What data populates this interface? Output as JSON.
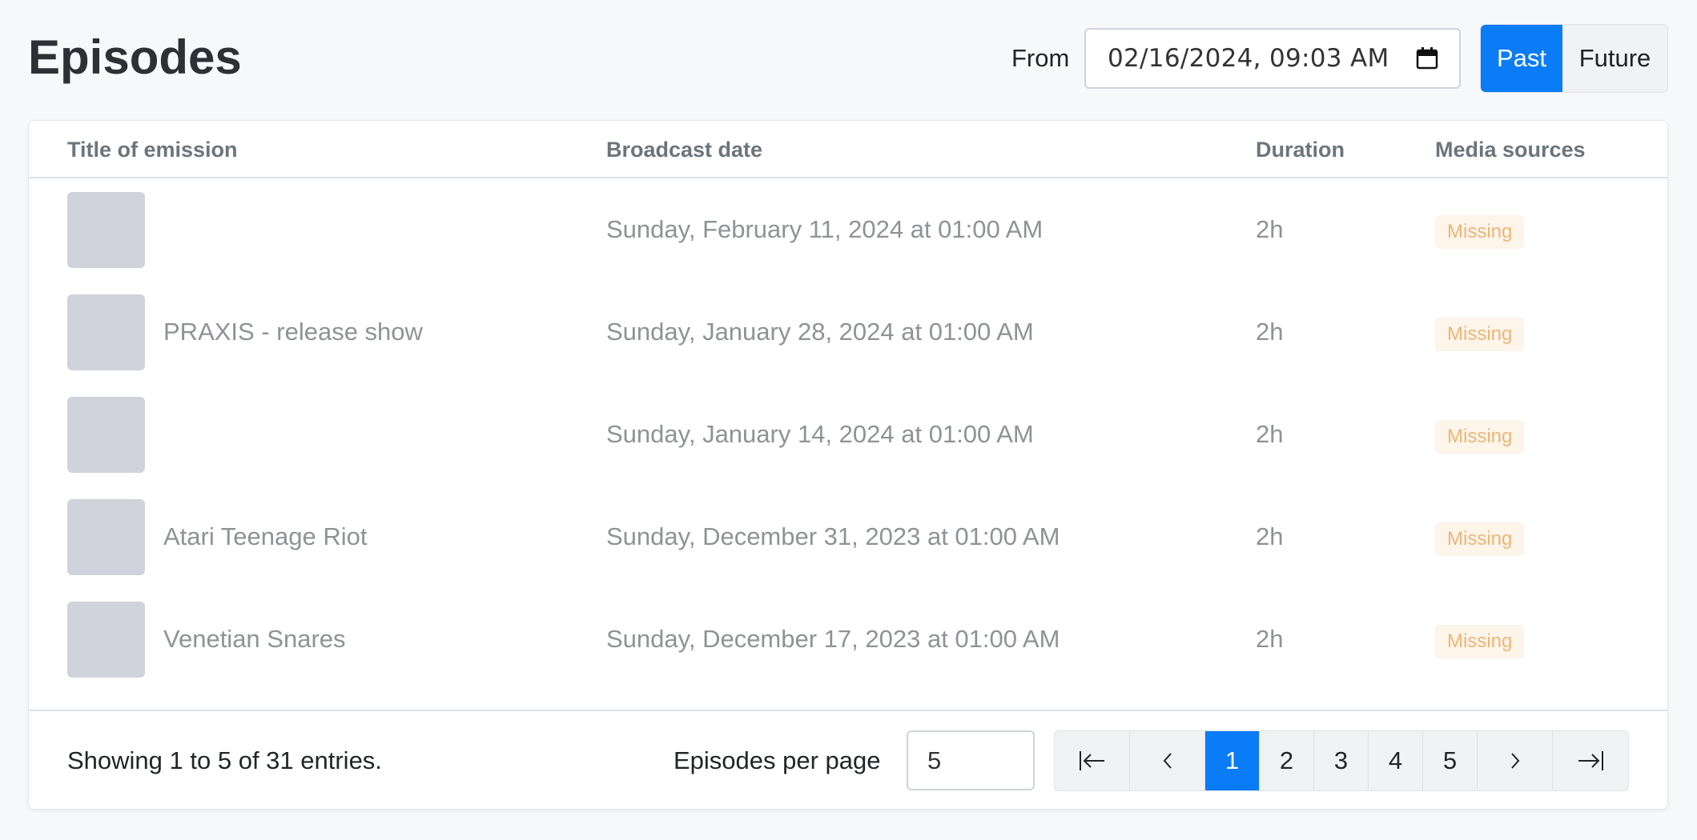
{
  "header": {
    "title": "Episodes",
    "from_label": "From",
    "date_value": "02/16/2024, 09:03 AM",
    "toggle": {
      "past": "Past",
      "future": "Future",
      "selected": "Past"
    }
  },
  "table": {
    "columns": [
      "Title of emission",
      "Broadcast date",
      "Duration",
      "Media sources"
    ],
    "rows": [
      {
        "title": "",
        "date": "Sunday, February 11, 2024 at 01:00 AM",
        "duration": "2h",
        "media": "Missing"
      },
      {
        "title": "PRAXIS - release show",
        "date": "Sunday, January 28, 2024 at 01:00 AM",
        "duration": "2h",
        "media": "Missing"
      },
      {
        "title": "",
        "date": "Sunday, January 14, 2024 at 01:00 AM",
        "duration": "2h",
        "media": "Missing"
      },
      {
        "title": "Atari Teenage Riot",
        "date": "Sunday, December 31, 2023 at 01:00 AM",
        "duration": "2h",
        "media": "Missing"
      },
      {
        "title": "Venetian Snares",
        "date": "Sunday, December 17, 2023 at 01:00 AM",
        "duration": "2h",
        "media": "Missing"
      }
    ]
  },
  "footer": {
    "showing": "Showing 1 to 5 of 31 entries.",
    "per_page_label": "Episodes per page",
    "per_page_value": "5",
    "pages": [
      "1",
      "2",
      "3",
      "4",
      "5"
    ],
    "current_page": "1"
  },
  "colors": {
    "accent": "#0a7cf6",
    "badge_text": "#e9b779",
    "badge_bg": "#fdf4ea"
  }
}
